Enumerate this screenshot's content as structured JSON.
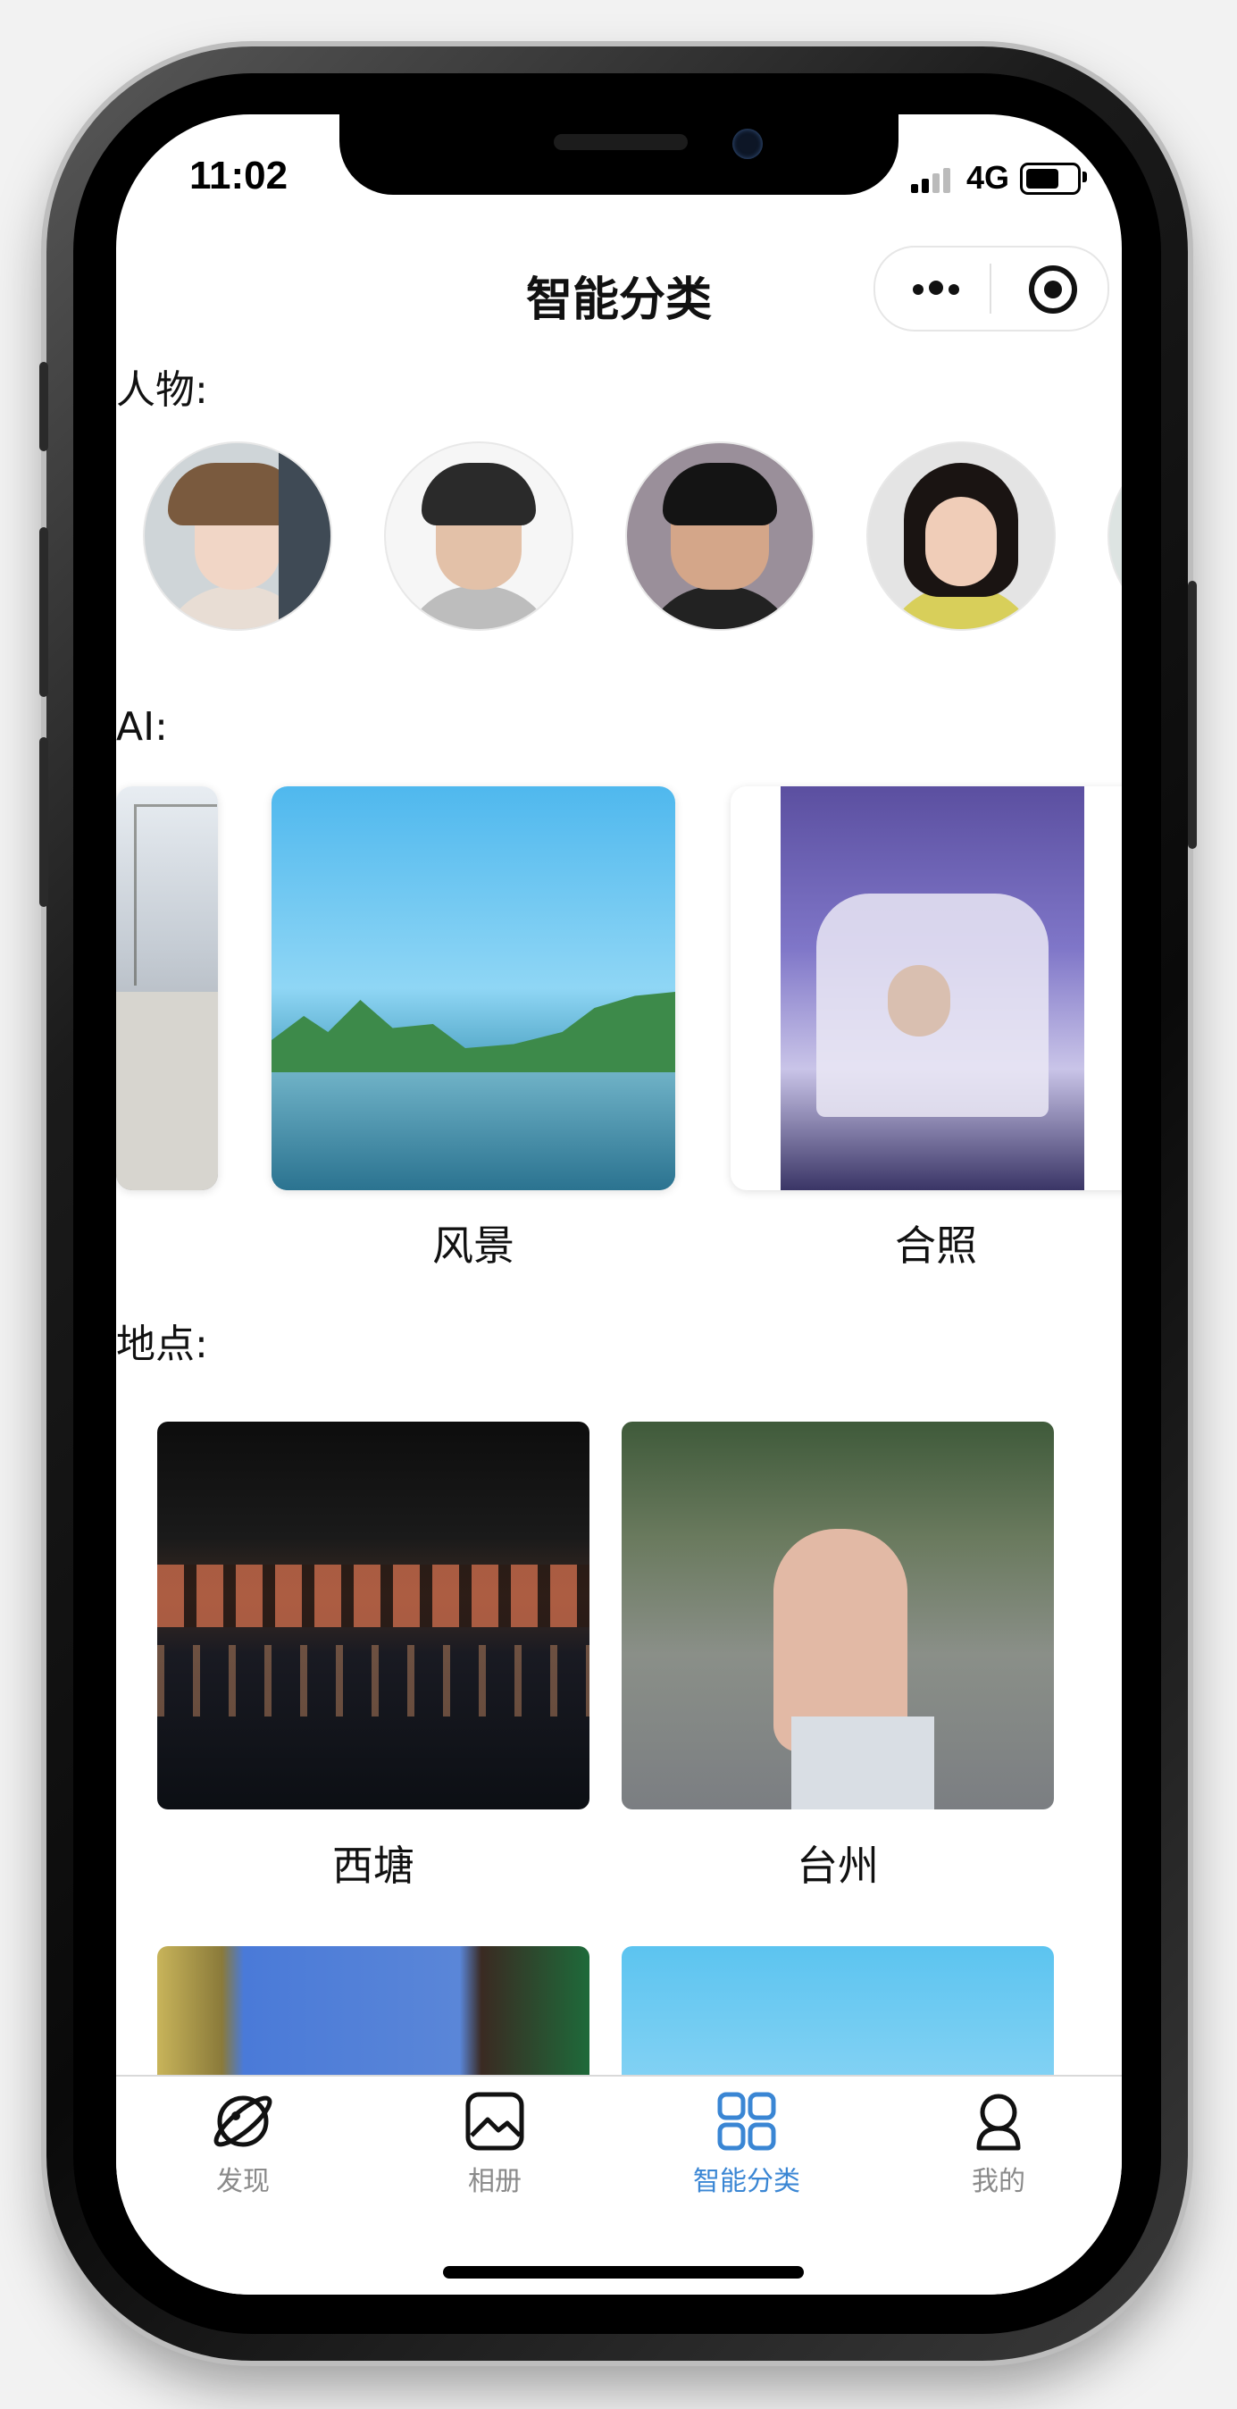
{
  "status_bar": {
    "time": "11:02",
    "network": "4G"
  },
  "header": {
    "title": "智能分类"
  },
  "sections": {
    "people": "人物:",
    "ai": "AI:",
    "places": "地点:"
  },
  "ai_cards": [
    {
      "label": "风景"
    },
    {
      "label": "合照"
    }
  ],
  "place_cards": [
    {
      "label": "西塘"
    },
    {
      "label": "台州"
    }
  ],
  "tabbar": {
    "items": [
      {
        "label": "发现",
        "icon": "planet-icon",
        "active": false
      },
      {
        "label": "相册",
        "icon": "album-icon",
        "active": false
      },
      {
        "label": "智能分类",
        "icon": "grid-icon",
        "active": true
      },
      {
        "label": "我的",
        "icon": "user-icon",
        "active": false
      }
    ]
  },
  "colors": {
    "active_tab": "#3a86d4",
    "inactive_tab": "#8a8a8a"
  }
}
